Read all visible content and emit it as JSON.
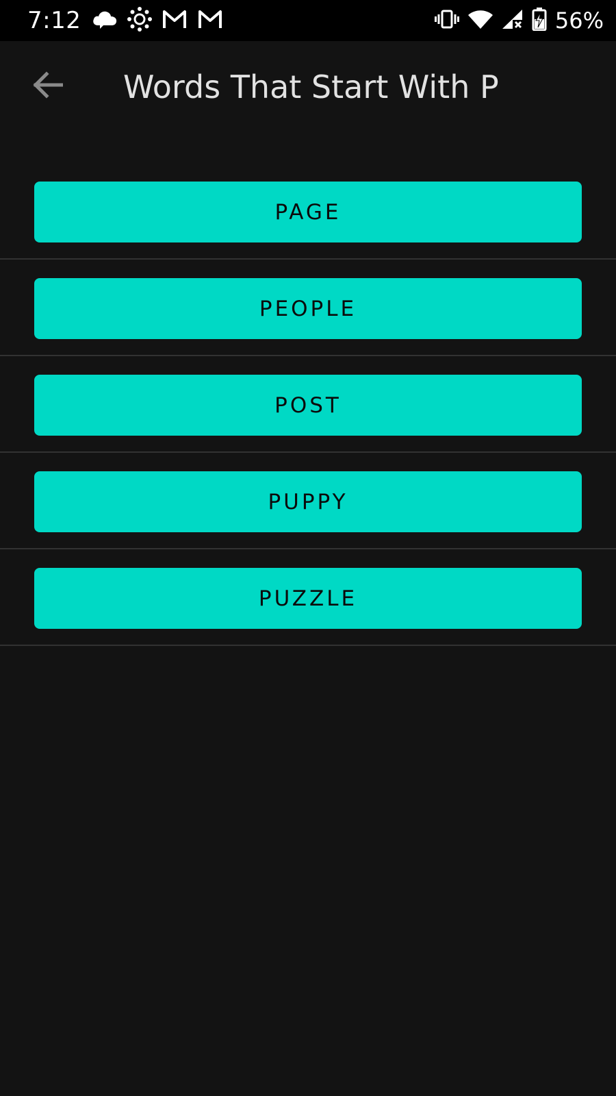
{
  "status_bar": {
    "time": "7:12",
    "left_icons": [
      "cloud-icon",
      "canvas-icon",
      "gmail-icon",
      "gmail-icon"
    ],
    "right_icons": [
      "vibrate-icon",
      "wifi-icon",
      "signal-icon",
      "battery-charging-icon"
    ],
    "battery_percent": "56%"
  },
  "app_bar": {
    "back_icon": "arrow-back-icon",
    "title": "Words That Start With P"
  },
  "words": [
    {
      "label": "PAGE"
    },
    {
      "label": "PEOPLE"
    },
    {
      "label": "POST"
    },
    {
      "label": "PUPPY"
    },
    {
      "label": "PUZZLE"
    }
  ],
  "colors": {
    "background": "#131313",
    "accent": "#00d9c5",
    "title_text": "#e2e2e2",
    "divider": "#323232"
  }
}
